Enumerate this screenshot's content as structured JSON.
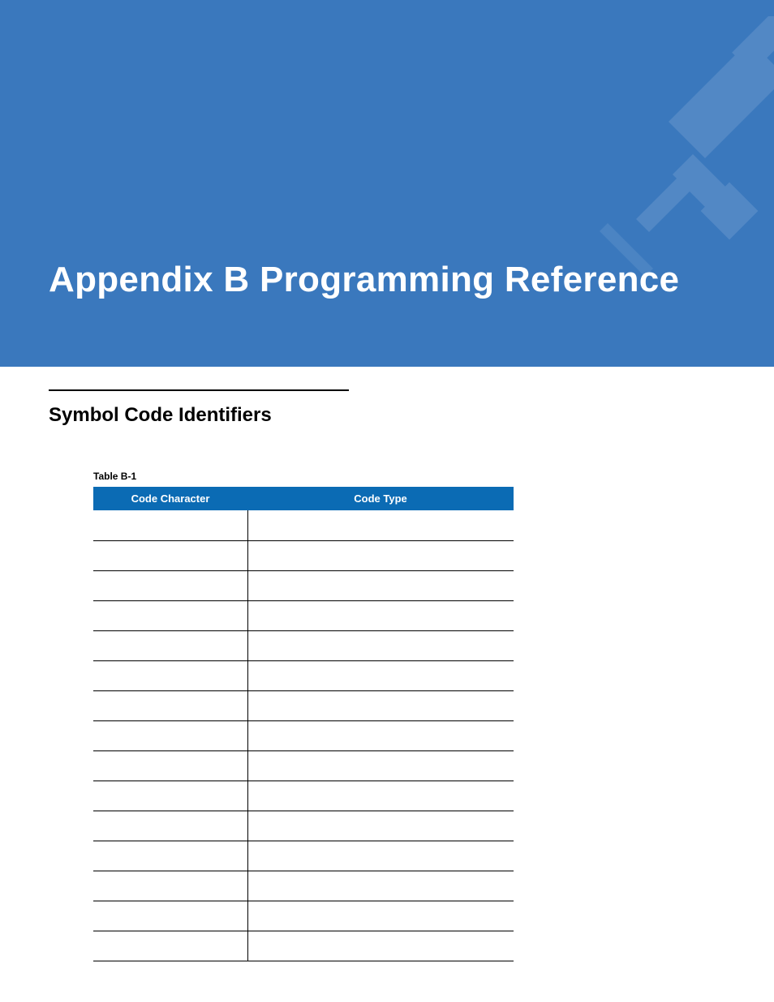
{
  "hero": {
    "title": "Appendix B  Programming Reference"
  },
  "section": {
    "title": "Symbol Code Identifiers"
  },
  "table": {
    "label": "Table B-1",
    "headers": [
      "Code Character",
      "Code Type"
    ],
    "rows": [
      {
        "char": "",
        "type": ""
      },
      {
        "char": "",
        "type": ""
      },
      {
        "char": "",
        "type": ""
      },
      {
        "char": "",
        "type": ""
      },
      {
        "char": "",
        "type": ""
      },
      {
        "char": "",
        "type": ""
      },
      {
        "char": "",
        "type": ""
      },
      {
        "char": "",
        "type": ""
      },
      {
        "char": "",
        "type": ""
      },
      {
        "char": "",
        "type": ""
      },
      {
        "char": "",
        "type": ""
      },
      {
        "char": "",
        "type": ""
      },
      {
        "char": "",
        "type": ""
      },
      {
        "char": "",
        "type": ""
      },
      {
        "char": "",
        "type": ""
      }
    ]
  }
}
